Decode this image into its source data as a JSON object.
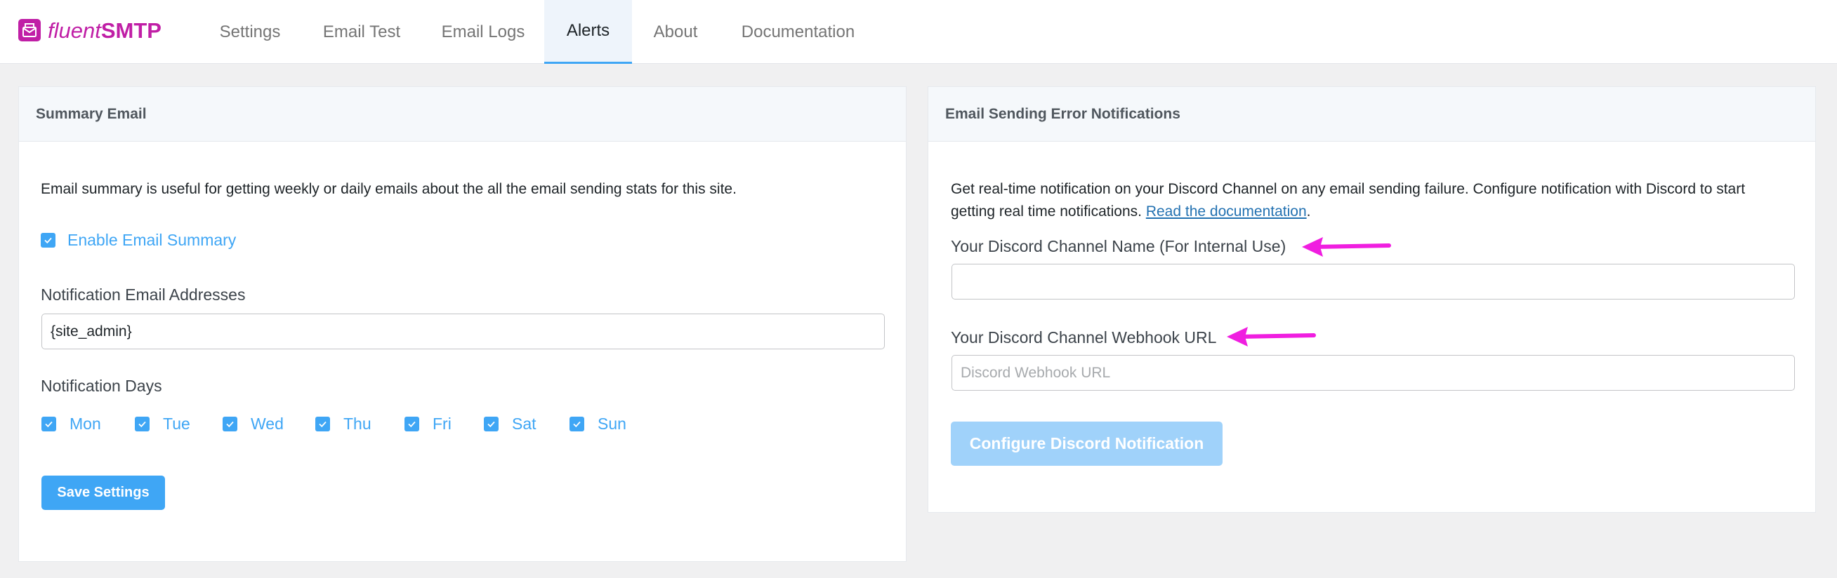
{
  "app": {
    "logo_light": "fluent",
    "logo_bold": "SMTP",
    "brand_color": "#c01fa6",
    "accent_color": "#3fa6f5"
  },
  "nav": {
    "tabs": [
      {
        "label": "Settings"
      },
      {
        "label": "Email Test"
      },
      {
        "label": "Email Logs"
      },
      {
        "label": "Alerts",
        "active": true
      },
      {
        "label": "About"
      },
      {
        "label": "Documentation"
      }
    ]
  },
  "summary": {
    "title": "Summary Email",
    "description": "Email summary is useful for getting weekly or daily emails about the all the email sending stats for this site.",
    "enable_label": "Enable Email Summary",
    "enable_checked": true,
    "emails_label": "Notification Email Addresses",
    "emails_value": "{site_admin}",
    "days_label": "Notification Days",
    "days": [
      {
        "label": "Mon",
        "checked": true
      },
      {
        "label": "Tue",
        "checked": true
      },
      {
        "label": "Wed",
        "checked": true
      },
      {
        "label": "Thu",
        "checked": true
      },
      {
        "label": "Fri",
        "checked": true
      },
      {
        "label": "Sat",
        "checked": true
      },
      {
        "label": "Sun",
        "checked": true
      }
    ],
    "save_label": "Save Settings"
  },
  "errors": {
    "title": "Email Sending Error Notifications",
    "description_line1": "Get real-time notification on your Discord Channel on any email sending failure. Configure notification with Discord to start",
    "description_line2": "getting real time notifications.",
    "doc_link": "Read the documentation",
    "doc_suffix": ".",
    "channel_name_label": "Your Discord Channel Name (For Internal Use)",
    "channel_name_value": "",
    "webhook_label": "Your Discord Channel Webhook URL",
    "webhook_placeholder": "Discord Webhook URL",
    "configure_label": "Configure Discord Notification",
    "arrow_color": "#f01ee0"
  }
}
